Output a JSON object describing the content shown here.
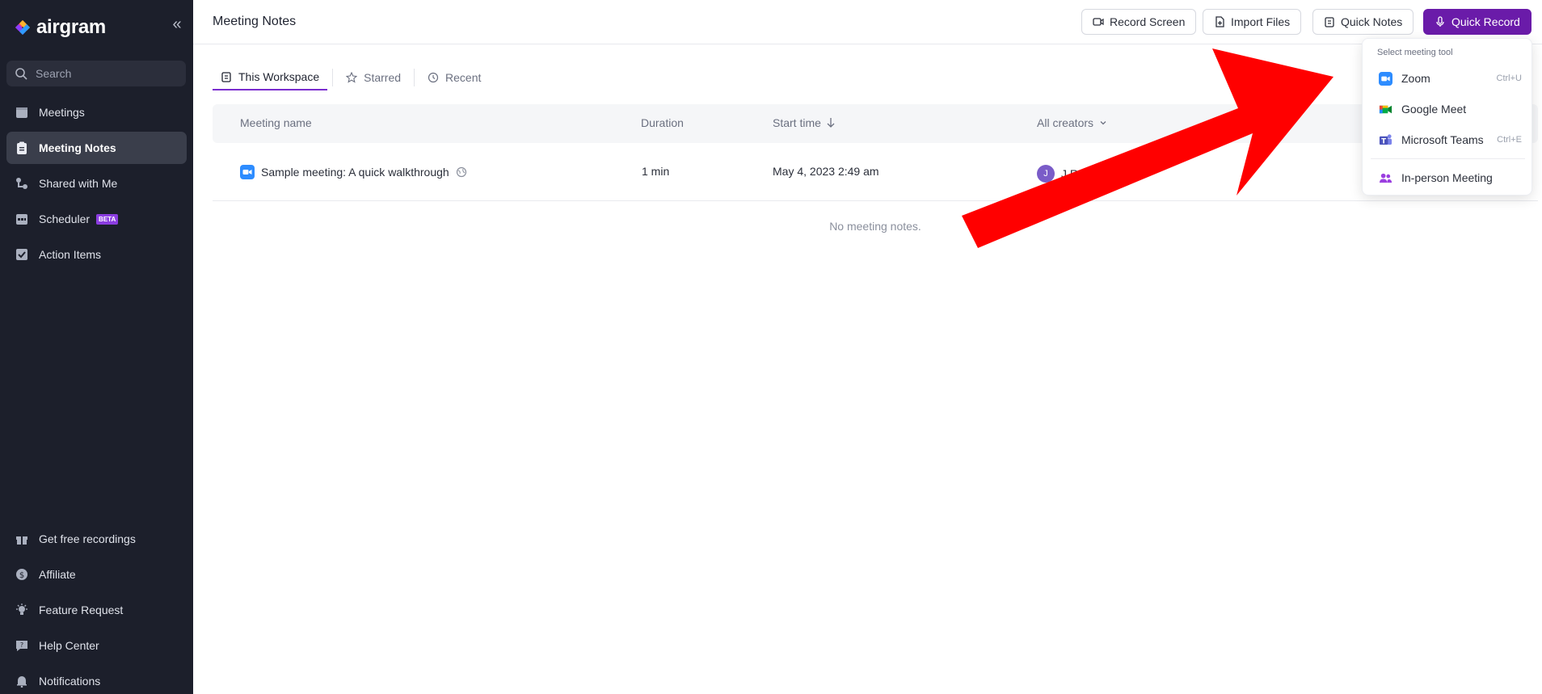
{
  "app": {
    "name": "airgram",
    "brand_color": "#6a1ba9"
  },
  "sidebar": {
    "search_placeholder": "Search",
    "items": [
      {
        "label": "Meetings",
        "icon": "calendar-icon"
      },
      {
        "label": "Meeting Notes",
        "icon": "clipboard-icon",
        "active": true
      },
      {
        "label": "Shared with Me",
        "icon": "share-icon"
      },
      {
        "label": "Scheduler",
        "icon": "scheduler-icon",
        "badge": "BETA"
      },
      {
        "label": "Action Items",
        "icon": "checkbox-icon"
      }
    ],
    "bottom_items": [
      {
        "label": "Get free recordings",
        "icon": "gift-icon"
      },
      {
        "label": "Affiliate",
        "icon": "dollar-icon"
      },
      {
        "label": "Feature Request",
        "icon": "lightbulb-icon"
      },
      {
        "label": "Help Center",
        "icon": "help-icon"
      },
      {
        "label": "Notifications",
        "icon": "bell-icon"
      }
    ]
  },
  "header": {
    "title": "Meeting Notes",
    "buttons": {
      "record_screen": "Record Screen",
      "import_files": "Import Files",
      "quick_notes": "Quick Notes",
      "quick_record": "Quick Record"
    }
  },
  "tabs": [
    {
      "label": "This Workspace",
      "active": true
    },
    {
      "label": "Starred"
    },
    {
      "label": "Recent"
    }
  ],
  "table": {
    "columns": [
      "Meeting name",
      "Duration",
      "Start time",
      "All creators"
    ],
    "rows": [
      {
        "name": "Sample meeting: A quick walkthrough",
        "duration": "1 min",
        "start_time": "May 4, 2023 2:49 am",
        "creator_initial": "J",
        "creator_name": "J R"
      }
    ],
    "empty_text": "No meeting notes."
  },
  "dropdown": {
    "title": "Select meeting tool",
    "items": [
      {
        "label": "Zoom",
        "shortcut": "Ctrl+U",
        "icon": "zoom-icon"
      },
      {
        "label": "Google Meet",
        "shortcut": "",
        "icon": "google-meet-icon"
      },
      {
        "label": "Microsoft Teams",
        "shortcut": "Ctrl+E",
        "icon": "teams-icon"
      },
      {
        "label": "In-person Meeting",
        "shortcut": "",
        "icon": "people-icon"
      }
    ]
  }
}
